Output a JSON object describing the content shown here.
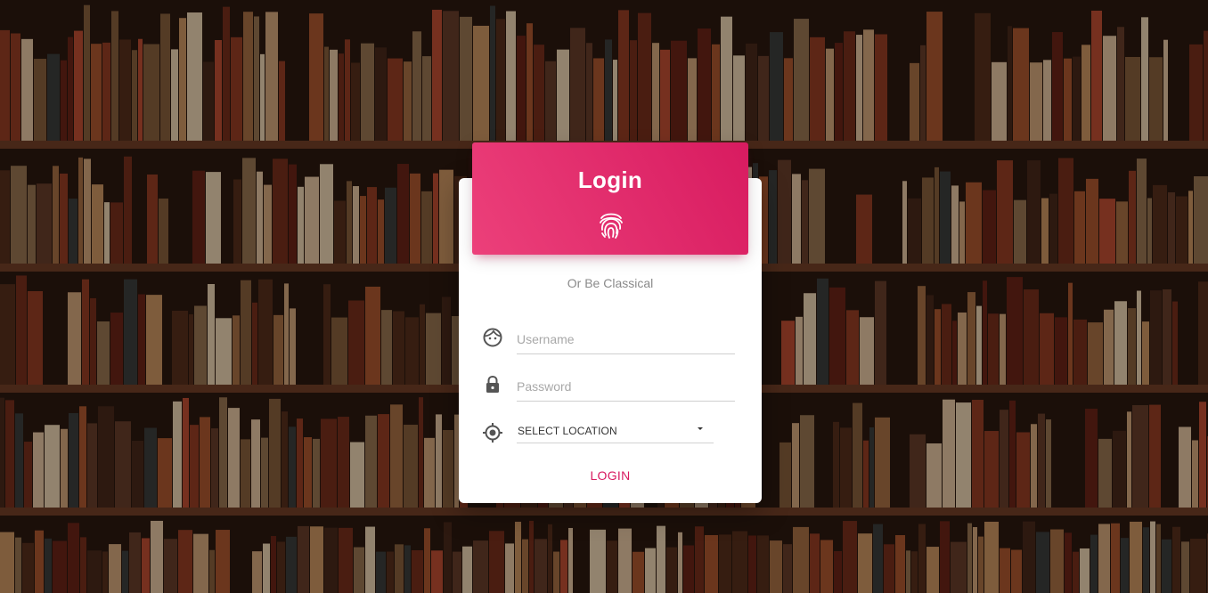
{
  "header": {
    "title": "Login",
    "icon": "fingerprint-icon"
  },
  "subtitle": "Or Be Classical",
  "form": {
    "username": {
      "placeholder": "Username",
      "value": "",
      "icon": "face-icon"
    },
    "password": {
      "placeholder": "Password",
      "value": "",
      "icon": "lock-icon"
    },
    "location": {
      "selected": "SELECT LOCATION",
      "icon": "location-target-icon"
    },
    "submit_label": "LOGIN"
  },
  "colors": {
    "accent": "#d81b60",
    "header_gradient_start": "#ec407a",
    "header_gradient_end": "#d81b60",
    "card_background": "#ffffff"
  },
  "background": {
    "description_icon": "bookshelf-background"
  }
}
